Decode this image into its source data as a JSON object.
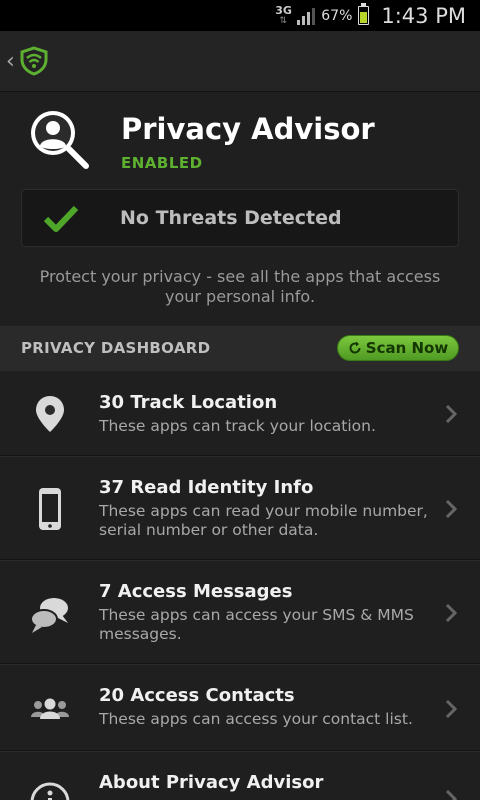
{
  "status_bar": {
    "network": "3G",
    "battery_percent": "67%",
    "battery_level": 0.67,
    "time": "1:43 PM"
  },
  "header": {
    "title": "Privacy Advisor",
    "status": "ENABLED",
    "threat_status": "No Threats Detected",
    "description": "Protect your privacy - see all the apps that access your personal info."
  },
  "dashboard": {
    "title": "PRIVACY DASHBOARD",
    "scan_label": "Scan Now",
    "items": [
      {
        "icon": "location-pin-icon",
        "label": "30 Track Location",
        "desc": "These apps can track your location."
      },
      {
        "icon": "phone-icon",
        "label": "37 Read Identity Info",
        "desc": "These apps can read your mobile number, serial number or other data."
      },
      {
        "icon": "chat-bubbles-icon",
        "label": "7 Access Messages",
        "desc": "These apps can access your SMS & MMS messages."
      },
      {
        "icon": "contacts-icon",
        "label": "20 Access Contacts",
        "desc": "These apps can access your contact list."
      },
      {
        "icon": "info-icon",
        "label": "About Privacy Advisor",
        "desc": ""
      }
    ]
  },
  "colors": {
    "accent_green": "#5eb130",
    "background": "#1f1f1f"
  }
}
